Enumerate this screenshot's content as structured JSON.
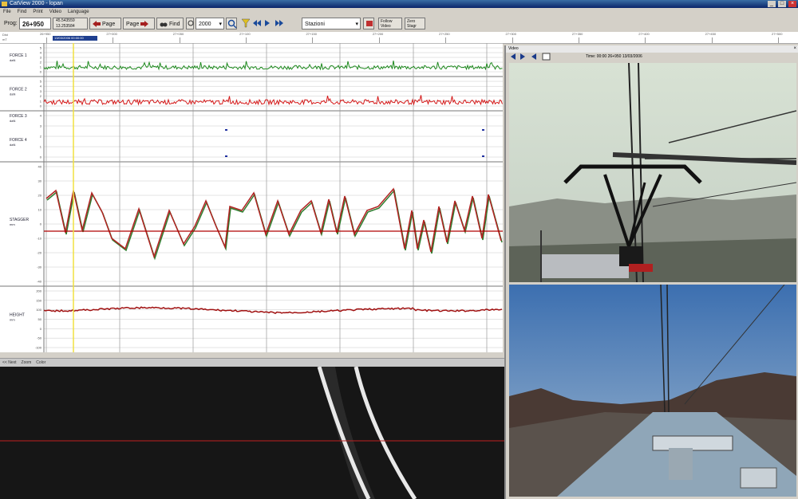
{
  "window": {
    "title": "CatView 2000 - lopan",
    "min": "_",
    "max": "□",
    "close": "×"
  },
  "menu": [
    "File",
    "Find",
    "Print",
    "Video",
    "Language"
  ],
  "toolbar": {
    "km_label": "Prog:",
    "km_value": "26+950",
    "coord_line1": "45.543559",
    "coord_line2": "13.253584",
    "page_back": "Page",
    "page_forward": "Page",
    "find": "Find",
    "zoom_value": "2000",
    "station_value": "Stazioni",
    "follow_video": "Follow Video",
    "zero_stagger": "Zero Stagr"
  },
  "km_strip": {
    "left_label_top": "Dist",
    "left_label_bottom": "mT",
    "marker": "13/03/2006 00:00:00",
    "ticks": [
      "26+950",
      "27+000",
      "27+050",
      "27+100",
      "27+150",
      "27+200",
      "27+250",
      "27+300",
      "27+350",
      "27+400",
      "27+450",
      "27+500"
    ]
  },
  "channels": [
    {
      "name": "FORCE 1",
      "unit": "daN"
    },
    {
      "name": "FORCE 2",
      "unit": "daN"
    },
    {
      "name": "FORCE 3",
      "unit": "daN"
    },
    {
      "name": "FORCE 4",
      "unit": "daN"
    },
    {
      "name": "STAGGER",
      "unit": "mm"
    },
    {
      "name": "HEIGHT",
      "unit": "mm"
    }
  ],
  "axis_ticks": {
    "force1": [
      "5",
      "4",
      "3",
      "2",
      "1",
      "0"
    ],
    "force2": [
      "5",
      "4",
      "3",
      "2",
      "1",
      "0"
    ],
    "force34": [
      "4",
      "3",
      "2",
      "1",
      "0"
    ],
    "stagger": [
      "40",
      "30",
      "20",
      "10",
      "0",
      "-10",
      "-20",
      "-30",
      "-40"
    ],
    "height": [
      "200",
      "150",
      "100",
      "50",
      "0",
      "-50",
      "-100"
    ]
  },
  "bottom_menu": [
    "<< Next",
    "Zoom",
    "Color"
  ],
  "video": {
    "title": "Video",
    "close": "×",
    "time_label": "Time: 00:00  26+950  13/03/2006"
  },
  "colors": {
    "force1": "#1e8a1e",
    "force2": "#d41818",
    "stagger": "#b22222",
    "stagger_shadow": "#2e7d2e",
    "height": "#a01010",
    "cursor": "#f0e040",
    "baseline": "#b00000"
  }
}
